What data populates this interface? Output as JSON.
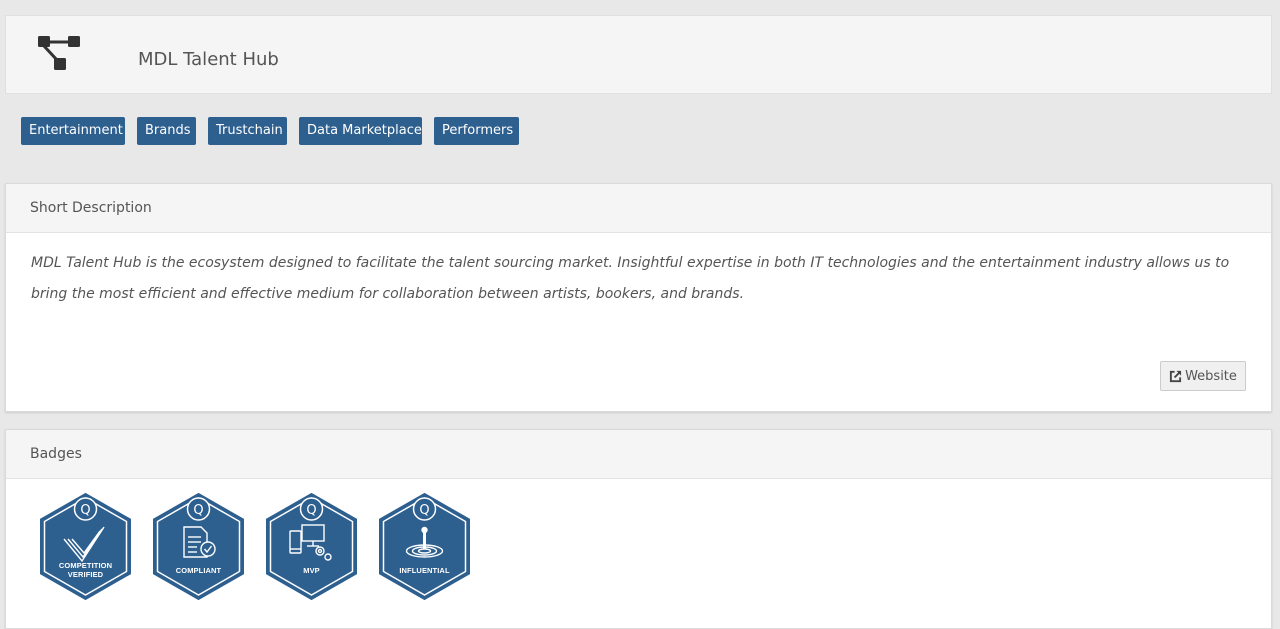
{
  "app": {
    "title": "MDL Talent Hub",
    "logo_icon": "network-nodes-icon"
  },
  "tags": [
    "Entertainment",
    "Brands",
    "Trustchain",
    "Data Marketplace",
    "Performers"
  ],
  "description": {
    "heading": "Short Description",
    "text": "MDL Talent Hub is the ecosystem designed to facilitate the talent sourcing market. Insightful expertise in both IT technologies and the entertainment industry allows us to bring the most efficient and effective medium for collaboration between artists, bookers, and brands.",
    "website_label": "Website",
    "website_icon": "external-link-icon"
  },
  "badges": {
    "heading": "Badges",
    "items": [
      {
        "line1": "COMPETITION",
        "line2": "VERIFIED",
        "icon": "checkmark-icon"
      },
      {
        "line1": "COMPLIANT",
        "line2": "",
        "icon": "document-check-icon"
      },
      {
        "line1": "MVP",
        "line2": "",
        "icon": "devices-gears-icon"
      },
      {
        "line1": "INFLUENTIAL",
        "line2": "",
        "icon": "person-ripple-icon"
      }
    ]
  },
  "colors": {
    "accent": "#2d5f8f",
    "page_bg": "#e8e8e8"
  }
}
